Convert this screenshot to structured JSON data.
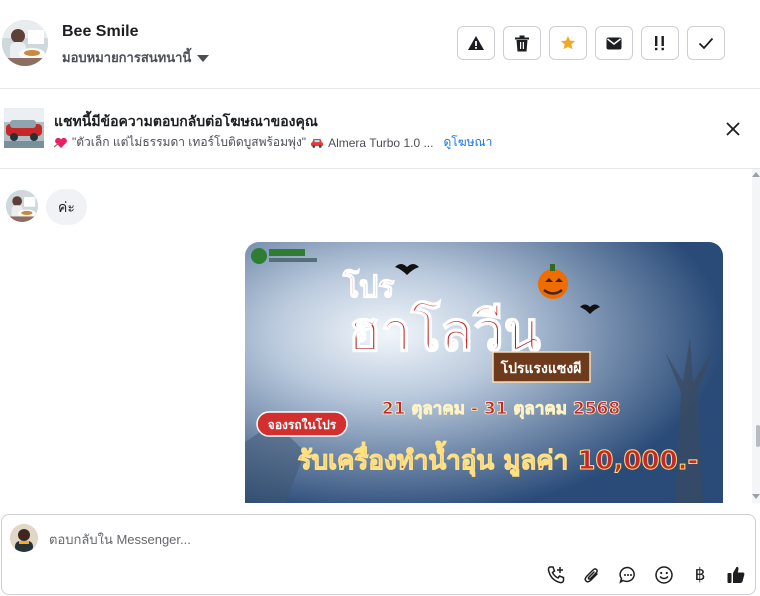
{
  "header": {
    "contact_name": "Bee Smile",
    "assign_label": "มอบหมายการสนทนานี้",
    "actions": [
      "warning-icon",
      "trash-icon",
      "star-icon",
      "mail-icon",
      "priority-icon",
      "check-icon"
    ],
    "star_color": "#f5a623"
  },
  "ad_reply": {
    "title": "แชทนี้มีข้อความตอบกลับต่อโฆษณาของคุณ",
    "ad_text": "\"ตัวเล็ก แต่ไม่ธรรมดา เทอร์โบติดบูสพร้อมพุ่ง\"",
    "car_text": "Almera Turbo 1.0 ...",
    "link_label": "ดูโฆษณา"
  },
  "chat": {
    "message_text": "ค่ะ",
    "promo": {
      "title_top": "โปร",
      "title_main": "ฮาโลวีน",
      "badge": "โปรแรงแซงผี",
      "date_range": "21 ตุลาคม - 31 ตุลาคม 2568",
      "tag": "จองรถในโปร",
      "offer": "รับเครื่องทำน้ำอุ่น มูลค่า 10,000.-"
    }
  },
  "composer": {
    "placeholder": "ตอบกลับใน Messenger...",
    "value": "",
    "tools": [
      "call-add-icon",
      "attachment-icon",
      "saved-reply-icon",
      "emoji-icon",
      "baht-icon",
      "like-icon"
    ],
    "baht_symbol": "฿"
  }
}
